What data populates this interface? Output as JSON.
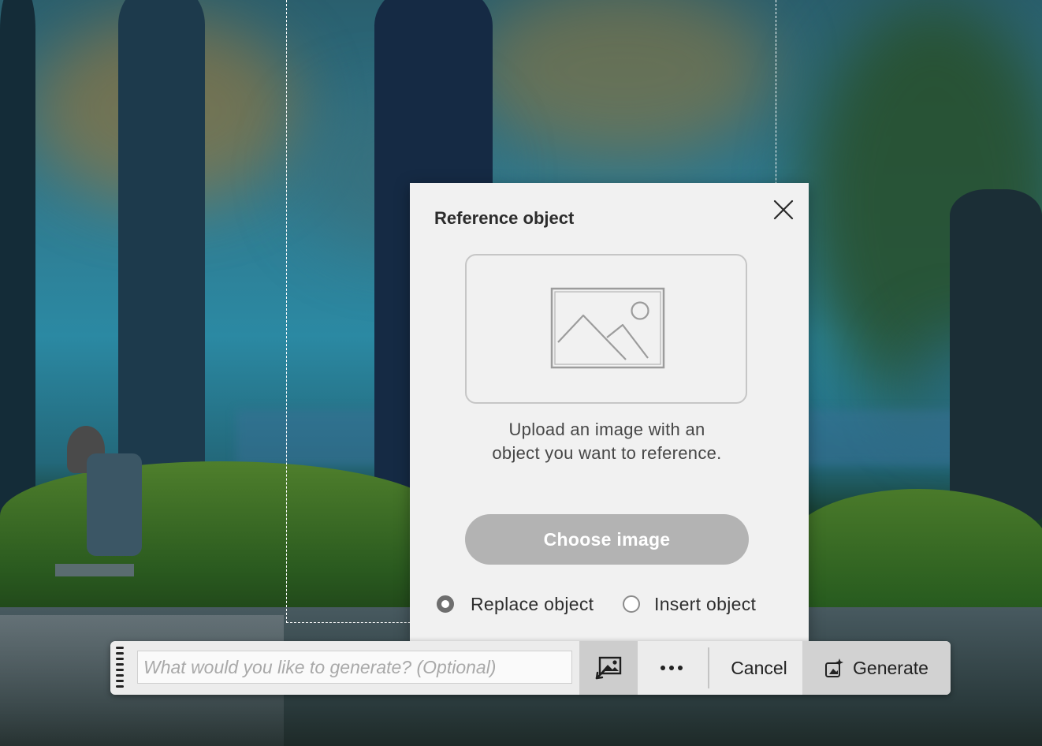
{
  "popover": {
    "title": "Reference object",
    "close_icon": "close-icon",
    "dropzone_icon": "image-placeholder-icon",
    "upload_text_line1": "Upload an image with an",
    "upload_text_line2": "object you want to reference.",
    "choose_button": "Choose image",
    "options": [
      {
        "label": "Replace object",
        "selected": true
      },
      {
        "label": "Insert object",
        "selected": false
      }
    ]
  },
  "toolbar": {
    "prompt_placeholder": "What would you like to generate? (Optional)",
    "prompt_value": "",
    "reference_icon": "reference-image-icon",
    "more_icon": "more-icon",
    "cancel_label": "Cancel",
    "generate_label": "Generate",
    "generate_icon": "generate-icon"
  },
  "colors": {
    "popover_bg": "#f1f1f1",
    "choose_button_bg": "#b3b3b3",
    "toolbar_bg": "#ececec",
    "active_button_bg": "#cdcdcd"
  }
}
